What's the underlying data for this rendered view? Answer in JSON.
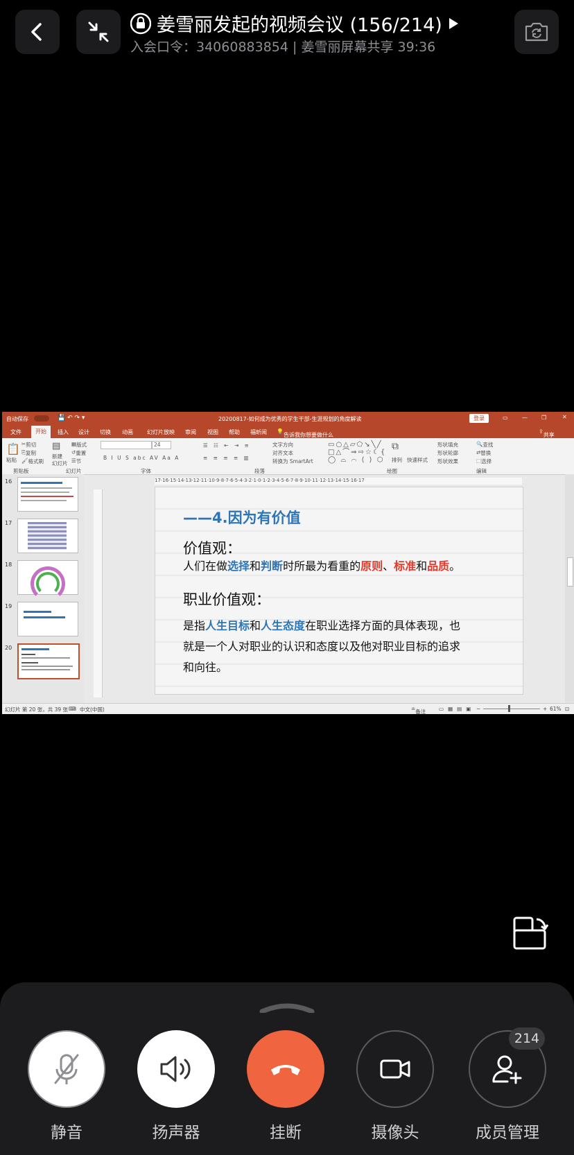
{
  "header": {
    "meeting_title": "姜雪丽发起的视频会议 (156/214)",
    "meeting_info": "入会口令：34060883854 | 姜雪丽屏幕共享  39:36"
  },
  "ppt": {
    "window_title": "20200817-如何成为优秀的学生干部-生涯规划的角度解读",
    "autosave": "自动保存",
    "login": "登录",
    "menu": [
      "文件",
      "开始",
      "插入",
      "设计",
      "切换",
      "动画",
      "幻灯片放映",
      "审阅",
      "视图",
      "帮助",
      "福昕阅",
      "告诉我你想要做什么"
    ],
    "share": "共享",
    "ribbon": {
      "paste": "粘贴",
      "cut": "剪切",
      "copy": "复制",
      "format_painter": "格式刷",
      "new_slide": "新建\n幻灯片",
      "layout": "版式",
      "reset": "重置",
      "section": "节",
      "clipboard_group": "剪贴板",
      "slides_group": "幻灯片",
      "font_group": "字体",
      "paragraph_group": "段落",
      "drawing_group": "绘图",
      "edit_group": "编辑",
      "text_direction": "文字方向",
      "align_text": "对齐文本",
      "smartart": "转换为 SmartArt",
      "arrange": "排列",
      "quick_styles": "快速样式",
      "shape_fill": "形状填充",
      "shape_outline": "形状轮廓",
      "shape_effects": "形状效果",
      "find": "查找",
      "replace": "替换",
      "select": "选择",
      "font_size": "24"
    },
    "thumbnails": [
      "16",
      "17",
      "18",
      "19",
      "20"
    ],
    "ruler_text": "17·16·15·14·13·12·11·10·9·8·7·6·5·4·3·2·1·0·1·2·3·4·5·6·7·8·9·10·11·12·13·14·15·16·17",
    "statusbar": {
      "slide_count": "幻灯片 第 20 张，共 39 张",
      "language": "中文(中国)",
      "notes": "备注",
      "zoom": "61%"
    },
    "slide": {
      "heading": "——4.因为有价值",
      "h1": "价值观：",
      "line1_a": "人们在做",
      "line1_b": "选择",
      "line1_c": "和",
      "line1_d": "判断",
      "line1_e": "时所最为看重的",
      "line1_f": "原则",
      "line1_g": "、",
      "line1_h": "标准",
      "line1_i": "和",
      "line1_j": "品质",
      "line1_k": "。",
      "h2": "职业价值观：",
      "line2_a": "是指",
      "line2_b": "人生目标",
      "line2_c": "和",
      "line2_d": "人生态度",
      "line2_e": "在职业选择方面的具体表现，也",
      "line3": "就是一个人对职业的认识和态度以及他对职业目标的追求",
      "line4": "和向往。"
    }
  },
  "controls": {
    "mute": "静音",
    "speaker": "扬声器",
    "hangup": "挂断",
    "camera": "摄像头",
    "members": "成员管理",
    "member_count": "214"
  },
  "colors": {
    "hangup": "#f0643f",
    "ppt_accent": "#b7472a",
    "slide_blue": "#2e75b6",
    "slide_red": "#e03b2d"
  }
}
